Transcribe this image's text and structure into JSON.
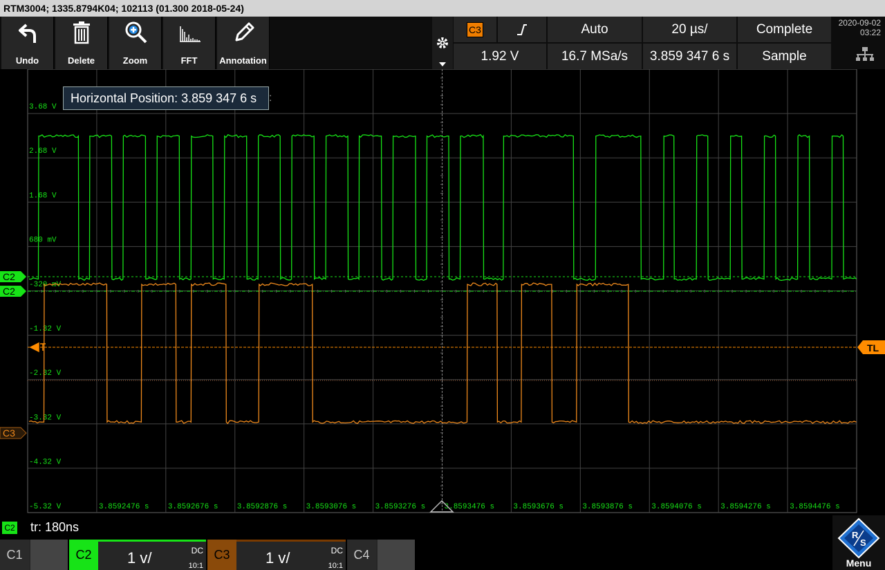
{
  "window": {
    "title": "RTM3004; 1335.8794K04; 102113 (01.300 2018-05-24)"
  },
  "toolbar": {
    "buttons": [
      {
        "label": "Undo",
        "icon": "undo-icon"
      },
      {
        "label": "Delete",
        "icon": "trash-icon"
      },
      {
        "label": "Zoom",
        "icon": "zoom-icon"
      },
      {
        "label": "FFT",
        "icon": "fft-icon"
      },
      {
        "label": "Annotation",
        "icon": "pencil-icon"
      }
    ]
  },
  "trigger": {
    "source": "C3",
    "slope_icon": "rising-edge-icon",
    "mode": "Auto",
    "level": "1.92 V",
    "timebase": "20 µs/",
    "sample_rate": "16.7 MSa/s",
    "status": "Complete",
    "position": "3.859 347 6 s",
    "acquisition": "Sample"
  },
  "clock": {
    "date": "2020-09-02",
    "time": "03:22"
  },
  "tooltip": {
    "text": "Horizontal Position: 3.859 347 6 s"
  },
  "y_labels": [
    "3.68 V",
    "2.68 V",
    "1.68 V",
    "680 mV",
    "-320 mV",
    "-1.32 V",
    "-2.32 V",
    "-3.32 V",
    "-4.32 V",
    "-5.32 V"
  ],
  "x_labels": [
    "3.8592476 s",
    "3.8592676 s",
    "3.8592876 s",
    "3.8593076 s",
    "3.8593276 s",
    "3.8593476 s",
    "3.8593676 s",
    "3.8593876 s",
    "3.8594076 s",
    "3.8594276 s",
    "3.8594476 s"
  ],
  "markers": {
    "c2": "C2",
    "c2_offset": "C2",
    "c3": "C3",
    "tl": "TL"
  },
  "status_bar": {
    "channel": "C2",
    "measurement": "tr: 180ns"
  },
  "channels": [
    {
      "name": "C1"
    },
    {
      "name": "C2",
      "scale": "1 v/",
      "coupling": "DC",
      "probe": "10:1"
    },
    {
      "name": "C3",
      "scale": "1 v/",
      "coupling": "DC",
      "probe": "10:1"
    },
    {
      "name": "C4"
    }
  ],
  "menu": {
    "label": "Menu"
  },
  "colors": {
    "c2": "#17e317",
    "c3": "#f08a1c",
    "tl": "#ff8c00",
    "grid": "#555555"
  },
  "waveforms": {
    "c2_high_volts": 3.0,
    "c2_low_volts": -0.22,
    "c3_high_volts": -0.34,
    "c3_low_volts": -3.44,
    "c2_edges": [
      0.0,
      3.2e-06,
      1.48e-05,
      1.8e-05,
      2.44e-05,
      2.77e-05,
      3.42e-05,
      3.75e-05,
      4.4e-05,
      4.74e-05,
      5.37e-05,
      5.7e-05,
      6.35e-05,
      6.68e-05,
      7.32e-05,
      7.65e-05,
      8.3e-05,
      8.64e-05,
      9.28e-05,
      9.6e-05,
      0.0001025,
      0.0001058,
      0.0001124,
      0.0001156,
      0.000122,
      0.0001253,
      0.000132,
      0.0001378,
      0.0001581,
      0.0001645,
      0.0001776,
      0.0001842,
      0.0001872,
      0.0001937,
      0.000197,
      0.0002035,
      0.0002068,
      0.0002133,
      0.0002166,
      0.000223,
      0.0002264,
      0.0002329,
      0.0002362
    ],
    "c3_edges": [
      0.0,
      4.8e-06,
      2.3e-05,
      3.3e-05,
      4.3e-05,
      4.74e-05,
      5.75e-05,
      6.7e-05,
      8.25e-05,
      0.0001273,
      0.000136,
      0.000143,
      0.0001518,
      0.000159,
      0.000174
    ],
    "c3_start_high": false
  }
}
